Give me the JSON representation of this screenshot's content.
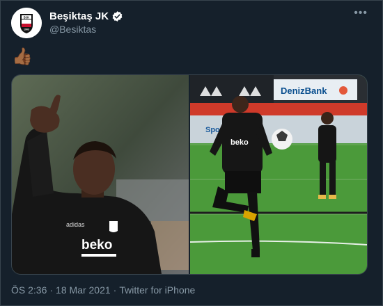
{
  "author": {
    "display_name": "Beşiktaş JK",
    "handle": "@Besiktas",
    "avatar_icon": "besiktas-crest-icon",
    "avatar_text": "BJK 1903",
    "verified": true
  },
  "menu": {
    "more_label": "•••"
  },
  "tweet": {
    "text": "👍🏾"
  },
  "media": {
    "left_photo": {
      "icon": "thumbs-up-player-photo",
      "shirt_text": "beko",
      "sponsor_brand": "adidas"
    },
    "right_photo": {
      "icon": "training-pitch-photo",
      "banner_text": "DenizBank",
      "banner_text_2": "Spor",
      "shirt_text": "beko"
    }
  },
  "footer": {
    "time": "ÖS 2:36",
    "separator1": "·",
    "date": "18 Mar 2021",
    "separator2": "·",
    "source": "Twitter for iPhone"
  },
  "colors": {
    "background": "#15202b",
    "border": "#38444d",
    "secondary_text": "#8899a6",
    "verified": "#1d9bf0"
  }
}
